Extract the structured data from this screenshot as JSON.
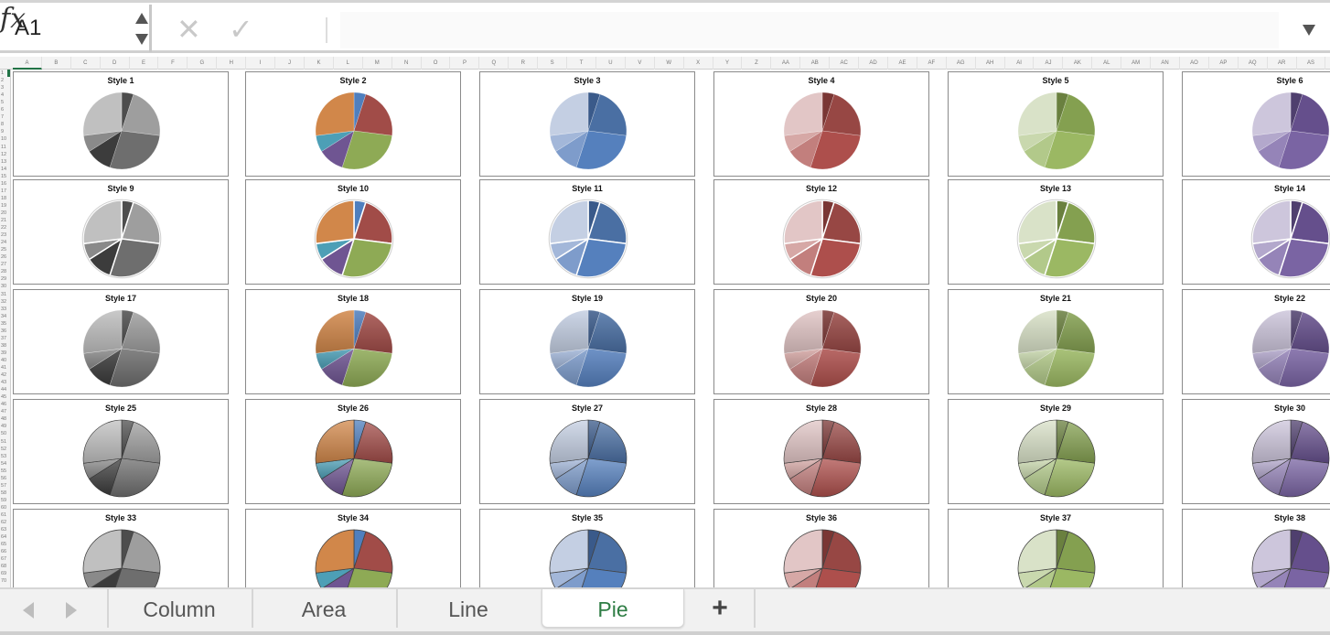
{
  "formula_bar": {
    "name_box": "A1",
    "cancel_icon": "✕",
    "enter_icon": "✓",
    "fx_label": "fx",
    "formula_value": ""
  },
  "columns": [
    "A",
    "B",
    "C",
    "D",
    "E",
    "F",
    "G",
    "H",
    "I",
    "J",
    "K",
    "L",
    "M",
    "N",
    "O",
    "P",
    "Q",
    "R",
    "S",
    "T",
    "U",
    "V",
    "W",
    "X",
    "Y",
    "Z",
    "AA",
    "AB",
    "AC",
    "AD",
    "AE",
    "AF",
    "AG",
    "AH",
    "AI",
    "AJ",
    "AK",
    "AL",
    "AM",
    "AN",
    "AO",
    "AP",
    "AQ",
    "AR",
    "AS"
  ],
  "selected_column": "A",
  "rows_visible": 70,
  "selected_row": 1,
  "chart_data": {
    "type": "pie",
    "values": [
      5,
      22,
      28,
      11,
      7,
      27
    ],
    "charts": [
      {
        "title": "Style 1",
        "palette": "gray",
        "effect": "flat"
      },
      {
        "title": "Style 2",
        "palette": "multi",
        "effect": "flat"
      },
      {
        "title": "Style 3",
        "palette": "blue",
        "effect": "flat"
      },
      {
        "title": "Style 4",
        "palette": "red",
        "effect": "flat"
      },
      {
        "title": "Style 5",
        "palette": "green",
        "effect": "flat"
      },
      {
        "title": "Style 6",
        "palette": "purple",
        "effect": "flat"
      },
      {
        "title": "Style 9",
        "palette": "gray",
        "effect": "outlined"
      },
      {
        "title": "Style 10",
        "palette": "multi",
        "effect": "outlined"
      },
      {
        "title": "Style 11",
        "palette": "blue",
        "effect": "outlined"
      },
      {
        "title": "Style 12",
        "palette": "red",
        "effect": "outlined"
      },
      {
        "title": "Style 13",
        "palette": "green",
        "effect": "outlined"
      },
      {
        "title": "Style 14",
        "palette": "purple",
        "effect": "outlined"
      },
      {
        "title": "Style 17",
        "palette": "gray",
        "effect": "gradient"
      },
      {
        "title": "Style 18",
        "palette": "multi",
        "effect": "gradient"
      },
      {
        "title": "Style 19",
        "palette": "blue",
        "effect": "gradient"
      },
      {
        "title": "Style 20",
        "palette": "red",
        "effect": "gradient"
      },
      {
        "title": "Style 21",
        "palette": "green",
        "effect": "gradient"
      },
      {
        "title": "Style 22",
        "palette": "purple",
        "effect": "gradient"
      },
      {
        "title": "Style 25",
        "palette": "gray",
        "effect": "bevel"
      },
      {
        "title": "Style 26",
        "palette": "multi",
        "effect": "bevel"
      },
      {
        "title": "Style 27",
        "palette": "blue",
        "effect": "bevel"
      },
      {
        "title": "Style 28",
        "palette": "red",
        "effect": "bevel"
      },
      {
        "title": "Style 29",
        "palette": "green",
        "effect": "bevel"
      },
      {
        "title": "Style 30",
        "palette": "purple",
        "effect": "bevel"
      },
      {
        "title": "Style 33",
        "palette": "gray",
        "effect": "dark-outline"
      },
      {
        "title": "Style 34",
        "palette": "multi",
        "effect": "dark-outline"
      },
      {
        "title": "Style 35",
        "palette": "blue",
        "effect": "dark-outline"
      },
      {
        "title": "Style 36",
        "palette": "red",
        "effect": "dark-outline"
      },
      {
        "title": "Style 37",
        "palette": "green",
        "effect": "dark-outline"
      },
      {
        "title": "Style 38",
        "palette": "purple",
        "effect": "dark-outline"
      }
    ],
    "palettes": {
      "gray": [
        "#4d4d4d",
        "#9e9e9e",
        "#6e6e6e",
        "#3c3c3c",
        "#8a8a8a",
        "#c0c0c0"
      ],
      "multi": [
        "#4f7fbe",
        "#a14c48",
        "#8eaa55",
        "#6f5592",
        "#4d9fb6",
        "#d1874a"
      ],
      "blue": [
        "#3a5a8a",
        "#4a6fa3",
        "#5580bd",
        "#7e9ccb",
        "#a3b7d9",
        "#c4cfe3"
      ],
      "red": [
        "#7a3634",
        "#974744",
        "#ad4f4c",
        "#c27f7d",
        "#d6a8a6",
        "#e2c6c6"
      ],
      "green": [
        "#6a803f",
        "#84a050",
        "#9bb863",
        "#b2c98a",
        "#c9d8ae",
        "#d9e2c8"
      ],
      "purple": [
        "#4f3f6e",
        "#654f8c",
        "#7a64a3",
        "#9584b8",
        "#b3a8cc",
        "#cdc6dc"
      ]
    }
  },
  "sheet_tabs": {
    "tabs": [
      "Column",
      "Area",
      "Line",
      "Pie"
    ],
    "active": "Pie",
    "add_label": "+"
  },
  "colors": {
    "accent": "#217346",
    "active_tab_text": "#2e7d44"
  }
}
